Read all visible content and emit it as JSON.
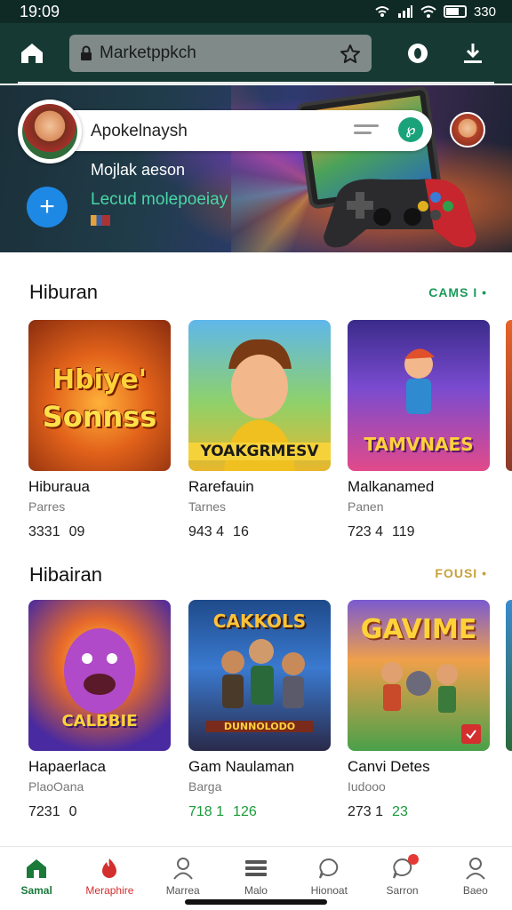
{
  "status_bar": {
    "time": "19:09",
    "battery": "330"
  },
  "browser": {
    "url": "Marketppkch"
  },
  "hero": {
    "profile_name": "Apokelnaysh",
    "subtitle": "Mojlak aeson",
    "link": "Lecud molepoeiay",
    "colors": {
      "accent": "#1aa37a",
      "plus": "#1e88e5",
      "link": "#49d6a6"
    }
  },
  "sections": [
    {
      "title": "Hiburan",
      "action": "CAMS I •",
      "action_color": "#1a9a5a",
      "cards": [
        {
          "thumb_text_1": "Hbiye'",
          "thumb_text_2": "Sonnss",
          "title": "Hiburaua",
          "subtitle": "Parres",
          "rating": "3331",
          "downloads": "09"
        },
        {
          "thumb_text_1": "YOAKGRMESV",
          "thumb_text_2": "",
          "title": "Rarefauin",
          "subtitle": "Tarnes",
          "rating": "943 4",
          "downloads": "16"
        },
        {
          "thumb_text_1": "TAMVNAES",
          "thumb_text_2": "",
          "title": "Malkanamed",
          "subtitle": "Panen",
          "rating": "723 4",
          "downloads": "119"
        }
      ]
    },
    {
      "title": "Hibairan",
      "action": "FOUSI •",
      "action_color": "#c8a23a",
      "cards": [
        {
          "thumb_text_1": "CALBBIE",
          "thumb_text_2": "",
          "title": "Hapaerlaca",
          "subtitle": "PlaoOana",
          "rating": "7231",
          "downloads": "0"
        },
        {
          "thumb_text_1": "CAKKOLS",
          "thumb_text_2": "DUNNOLODO",
          "title": "Gam Naulaman",
          "subtitle": "Barga",
          "rating": "718 1",
          "downloads": "126"
        },
        {
          "thumb_text_1": "GAVIME",
          "thumb_text_2": "",
          "title": "Canvi Detes",
          "subtitle": "Iudooo",
          "rating": "273 1",
          "downloads": "23"
        }
      ]
    }
  ],
  "nav": [
    {
      "label": "Samal",
      "icon": "home-icon",
      "active": true
    },
    {
      "label": "Meraphire",
      "icon": "fire-icon"
    },
    {
      "label": "Marrea",
      "icon": "person-icon"
    },
    {
      "label": "Malo",
      "icon": "list-icon"
    },
    {
      "label": "Hionoat",
      "icon": "chat-icon"
    },
    {
      "label": "Sarron",
      "icon": "notification-icon"
    },
    {
      "label": "Baeo",
      "icon": "profile-icon"
    }
  ],
  "nav_colors": {
    "active": "#1a7a3a",
    "fire": "#d32f2f"
  }
}
